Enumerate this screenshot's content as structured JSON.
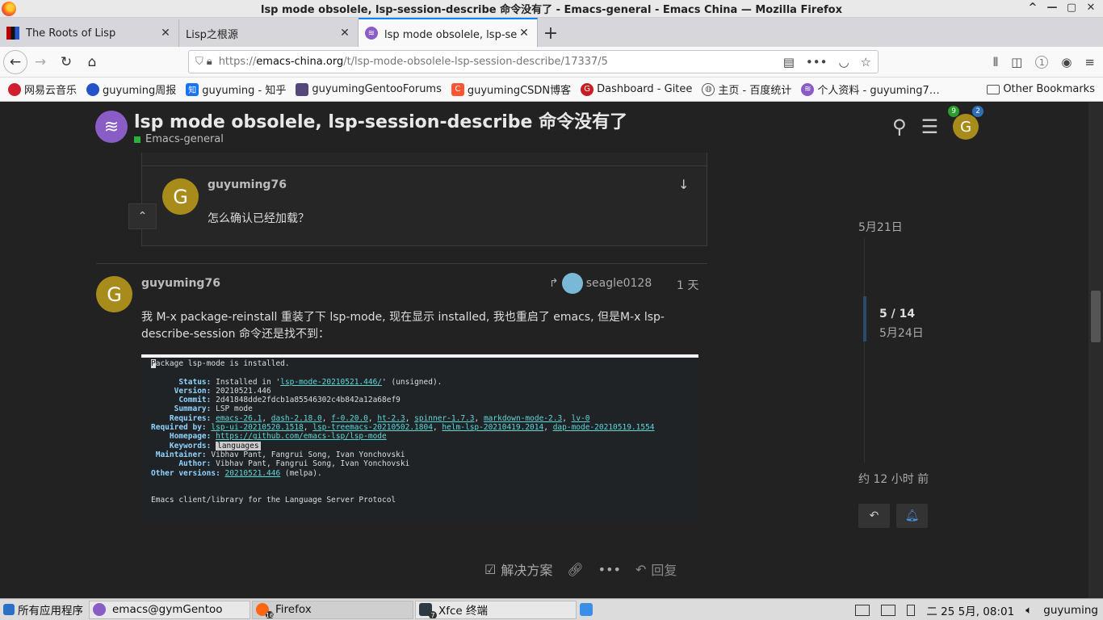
{
  "window": {
    "title": "lsp mode obsolele, lsp-session-describe 命令没有了 - Emacs-general - Emacs China — Mozilla Firefox",
    "controls": [
      "^",
      "—",
      "▢",
      "✕"
    ]
  },
  "tabs": [
    {
      "label": "The Roots of Lisp",
      "icon": "roots-favicon"
    },
    {
      "label": "Lisp之根源",
      "icon": "none"
    },
    {
      "label": "lsp mode obsolele, lsp-session-describe 命令没有了",
      "icon": "emacs-china-favicon",
      "active": true
    }
  ],
  "nav": {
    "url_prefix": "https://",
    "url_domain": "emacs-china.org",
    "url_path": "/t/lsp-mode-obsolele-lsp-session-describe/17337/5",
    "notification_count": "1"
  },
  "bookmarks": {
    "items": [
      {
        "label": "网易云音乐",
        "color": "#d01f2e"
      },
      {
        "label": "guyuming周报",
        "color": "#2453c9"
      },
      {
        "label": "guyuming - 知乎",
        "color": "#1772f6"
      },
      {
        "label": "guyumingGentooForums",
        "color": "#54487a"
      },
      {
        "label": "guyumingCSDN博客",
        "color": "#fc5531"
      },
      {
        "label": "Dashboard - Gitee",
        "color": "#c71d23"
      },
      {
        "label": "主页 - 百度统计",
        "color": "#555555"
      },
      {
        "label": "个人资料 - guyuming7…",
        "color": "#8a5cc6"
      }
    ],
    "other": "Other Bookmarks"
  },
  "header": {
    "logo": "≋",
    "title": "lsp mode obsolele, lsp-session-describe 命令没有了",
    "category": "Emacs-general",
    "category_color": "#2bb13a",
    "avatar_letter": "G",
    "badge_green": "9",
    "badge_blue": "2"
  },
  "quote": {
    "avatar_letter": "G",
    "username": "guyuming76",
    "text": "怎么确认已经加载？"
  },
  "post": {
    "avatar_letter": "G",
    "username": "guyuming76",
    "reply_to": "seagle0128",
    "time": "1 天",
    "text": "我 M-x package-reinstall 重装了下 lsp-mode, 现在显示 installed, 我也重启了 emacs, 但是M-x lsp-describe-session 命令还是找不到："
  },
  "emacs_screenshot": {
    "first_char": "P",
    "header": "ackage lsp-mode is installed.",
    "status_label": "Status:",
    "status_pre": "Installed in '",
    "status_link": "lsp-mode-20210521.446/",
    "status_post": "' (unsigned).",
    "version_label": "Version:",
    "version": "20210521.446",
    "commit_label": "Commit:",
    "commit": "2d41848dde2fdcb1a85546302c4b842a12a68ef9",
    "summary_label": "Summary:",
    "summary": "LSP mode",
    "requires_label": "Requires:",
    "requires": [
      "emacs-26.1",
      "dash-2.18.0",
      "f-0.20.0",
      "ht-2.3",
      "spinner-1.7.3",
      "markdown-mode-2.3",
      "lv-0"
    ],
    "required_by_label": "Required by:",
    "required_by": [
      "lsp-ui-20210520.1518",
      "lsp-treemacs-20210502.1804",
      "helm-lsp-20210419.2014",
      "dap-mode-20210519.1554"
    ],
    "homepage_label": "Homepage:",
    "homepage": "https://github.com/emacs-lsp/lsp-mode",
    "keywords_label": "Keywords:",
    "keywords": "languages",
    "maintainer_label": "Maintainer:",
    "maintainer": "Vibhav Pant, Fangrui Song, Ivan Yonchovski",
    "author_label": "Author:",
    "author": "Vibhav Pant, Fangrui Song, Ivan Yonchovski",
    "other_versions_label": "Other versions:",
    "other_versions_link": "20210521.446",
    "other_versions_post": "(melpa).",
    "description": "Emacs client/library for the Language Server Protocol"
  },
  "actions": {
    "solution_label": "解决方案",
    "reply_label": "回复"
  },
  "timeline": {
    "start_date": "5月21日",
    "position": "5 / 14",
    "position_date": "5月24日",
    "end_date": "约 12 小时 前"
  },
  "taskbar": {
    "start_label": "所有应用程序",
    "tasks": [
      {
        "label": "emacs@gymGentoo",
        "color": "#8a5cc6"
      },
      {
        "label": "Firefox",
        "color": "#ff6611",
        "count": "16"
      },
      {
        "label": "Xfce 终端",
        "color": "#2d3a44",
        "count": "7"
      }
    ],
    "datetime": "二 25 5月, 08:01",
    "user": "guyuming"
  }
}
